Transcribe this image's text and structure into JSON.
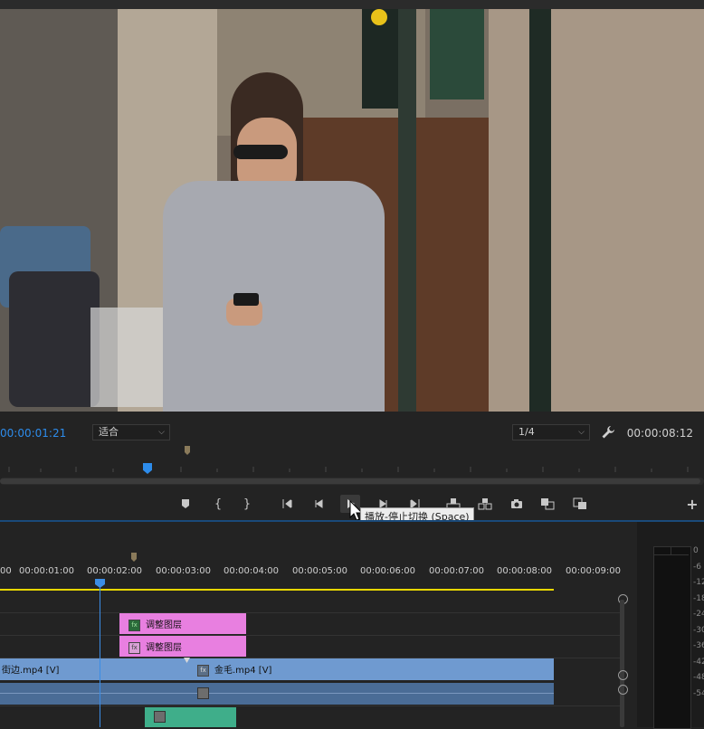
{
  "program_monitor": {
    "current_timecode": "00:00:01:21",
    "fit_dropdown": "适合",
    "resolution_dropdown": "1/4",
    "duration_timecode": "00:00:08:12"
  },
  "transport": {
    "tooltip": "播放-停止切换 (Space)"
  },
  "timeline": {
    "ruler_labels": [
      "00",
      "00:00:01:00",
      "00:00:02:00",
      "00:00:03:00",
      "00:00:04:00",
      "00:00:05:00",
      "00:00:06:00",
      "00:00:07:00",
      "00:00:08:00",
      "00:00:09:00"
    ],
    "clips": {
      "adjust_1": "调整图层",
      "adjust_2": "调整图层",
      "video_a": "街边.mp4 [V]",
      "video_b": "金毛.mp4 [V]"
    }
  },
  "audio_meter": {
    "labels": [
      "0",
      "-6",
      "-12",
      "-18",
      "-24",
      "-30",
      "-36",
      "-42",
      "-48",
      "-54"
    ]
  },
  "colors": {
    "accent_blue": "#2d8ceb",
    "adjustment_layer": "#e87fe0",
    "video_clip": "#6f9ad0",
    "audio_clip": "#3fae8a",
    "work_area": "#e8d800"
  }
}
